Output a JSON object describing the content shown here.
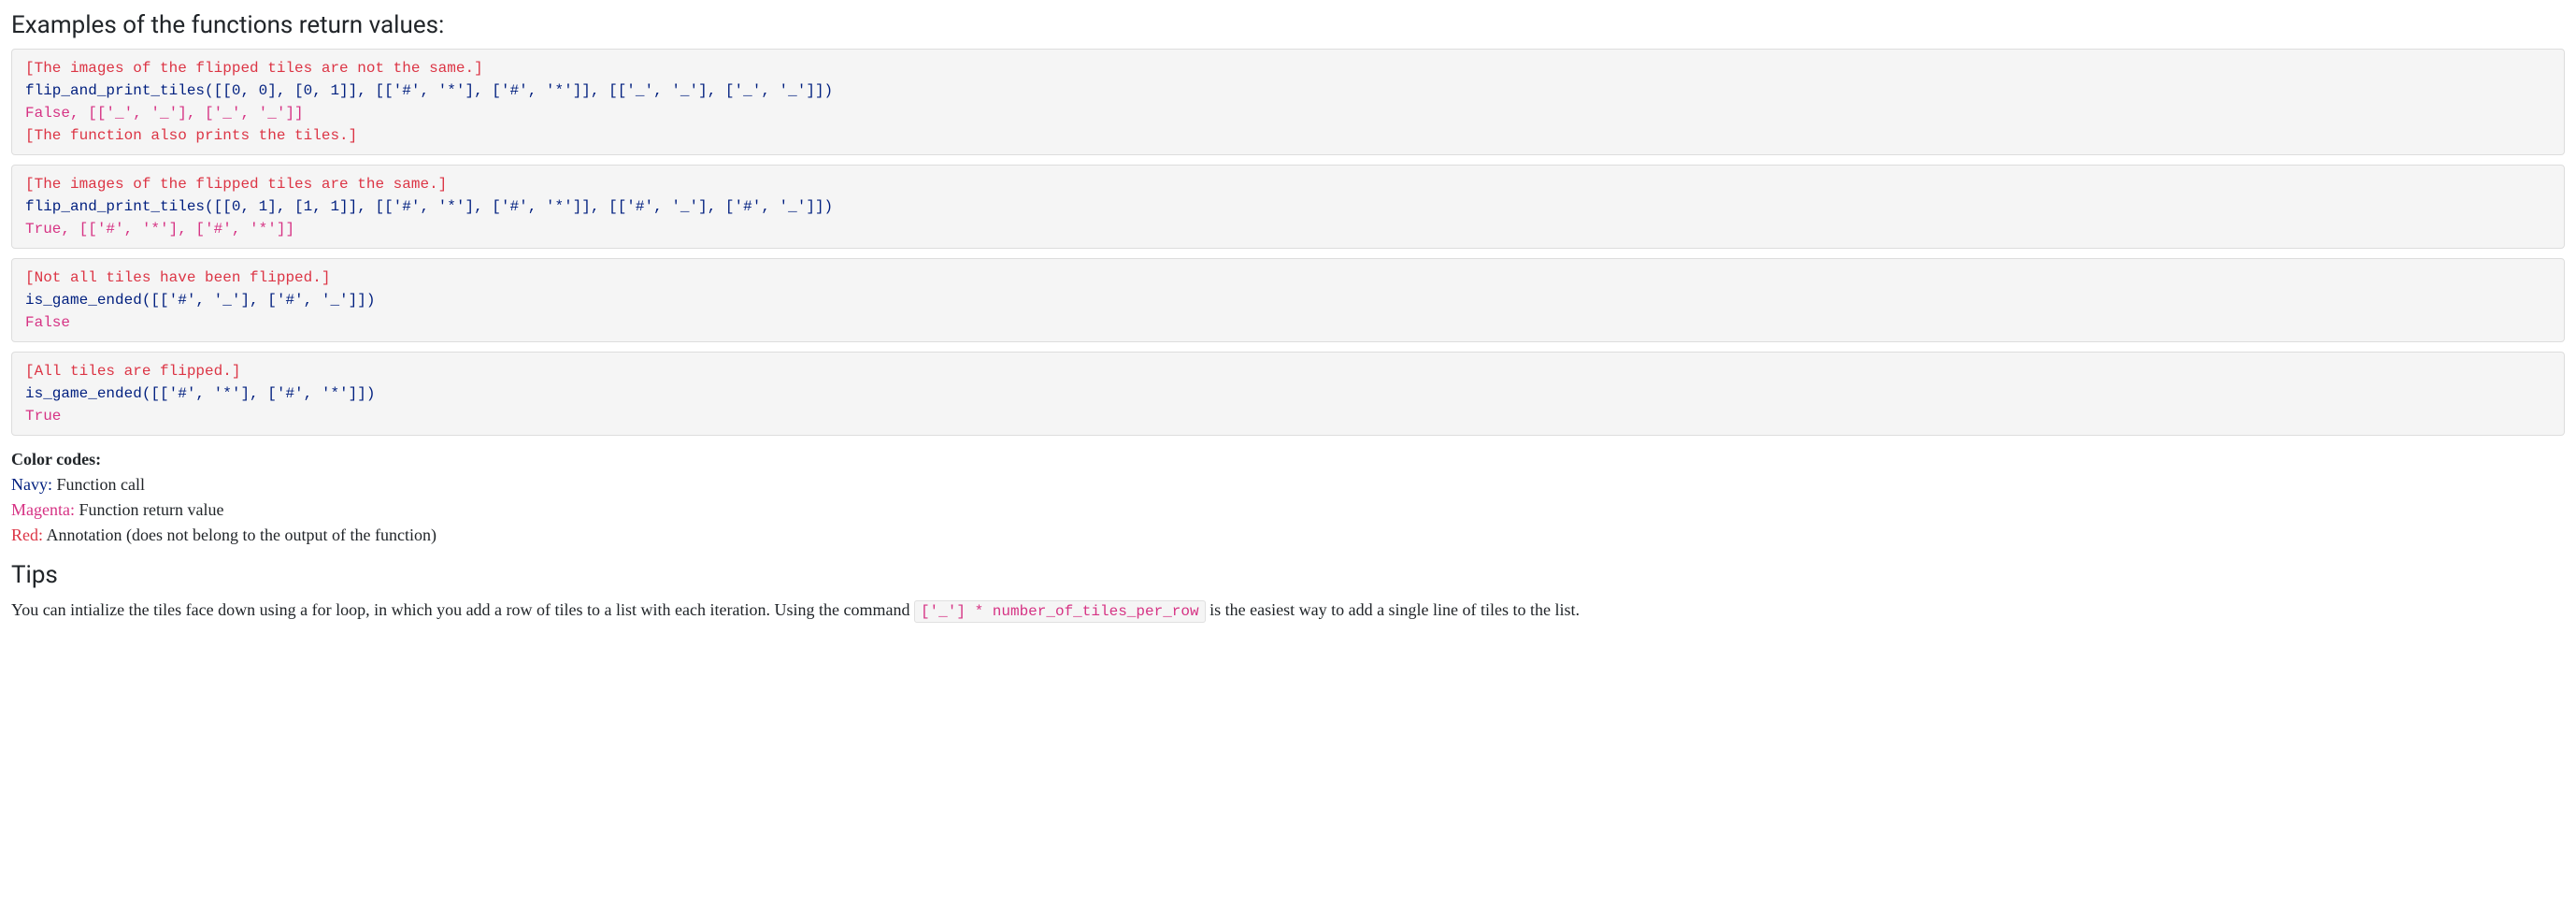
{
  "heading_examples": "Examples of the functions return values:",
  "blocks": [
    {
      "lines": [
        {
          "cls": "c-red",
          "text": "[The images of the flipped tiles are not the same.]"
        },
        {
          "cls": "c-navy",
          "text": "flip_and_print_tiles([[0, 0], [0, 1]], [['#', '*'], ['#', '*']], [['_', '_'], ['_', '_']])"
        },
        {
          "cls": "c-magenta",
          "text": "False, [['_', '_'], ['_', '_']]"
        },
        {
          "cls": "c-red",
          "text": "[The function also prints the tiles.]"
        }
      ]
    },
    {
      "lines": [
        {
          "cls": "c-red",
          "text": "[The images of the flipped tiles are the same.]"
        },
        {
          "cls": "c-navy",
          "text": "flip_and_print_tiles([[0, 1], [1, 1]], [['#', '*'], ['#', '*']], [['#', '_'], ['#', '_']])"
        },
        {
          "cls": "c-magenta",
          "text": "True, [['#', '*'], ['#', '*']]"
        }
      ]
    },
    {
      "lines": [
        {
          "cls": "c-red",
          "text": "[Not all tiles have been flipped.]"
        },
        {
          "cls": "c-navy",
          "text": "is_game_ended([['#', '_'], ['#', '_']])"
        },
        {
          "cls": "c-magenta",
          "text": "False"
        }
      ]
    },
    {
      "lines": [
        {
          "cls": "c-red",
          "text": "[All tiles are flipped.]"
        },
        {
          "cls": "c-navy",
          "text": "is_game_ended([['#', '*'], ['#', '*']])"
        },
        {
          "cls": "c-magenta",
          "text": "True"
        }
      ]
    }
  ],
  "color_codes": {
    "title": "Color codes:",
    "navy_label": "Navy:",
    "navy_desc": " Function call",
    "magenta_label": "Magenta:",
    "magenta_desc": " Function return value",
    "red_label": "Red:",
    "red_desc": " Annotation (does not belong to the output of the function)"
  },
  "tips": {
    "heading": "Tips",
    "prefix": "You can intialize the tiles face down using a for loop, in which you add a row of tiles to a list with each iteration. Using the command ",
    "code": "['_'] * number_of_tiles_per_row",
    "suffix": " is the easiest way to add a single line of tiles to the list."
  }
}
